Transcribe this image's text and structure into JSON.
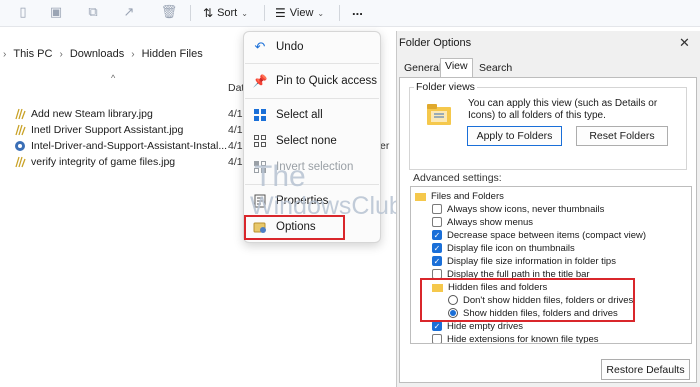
{
  "toolbar": {
    "sort_label": "Sort",
    "view_label": "View",
    "more_label": "..."
  },
  "breadcrumb": {
    "segments": [
      "This PC",
      "Downloads",
      "Hidden Files"
    ]
  },
  "file_list": {
    "files": [
      {
        "name": "Add new Steam library.jpg",
        "date": "4/1"
      },
      {
        "name": "Inetl Driver Support Assistant.jpg",
        "date": "4/1"
      },
      {
        "name": "Intel-Driver-and-Support-Assistant-Instal...",
        "date": "4/1"
      },
      {
        "name": "verify integrity of game files.jpg",
        "date": "4/1"
      }
    ],
    "date_header": "Dat",
    "overflow_text": "older"
  },
  "context_menu": {
    "items": [
      {
        "label": "Undo",
        "icon": "undo-icon",
        "disabled": false
      },
      {
        "label": "Pin to Quick access",
        "icon": "pin-icon",
        "disabled": false
      },
      {
        "label": "Select all",
        "icon": "select-all-icon",
        "disabled": false
      },
      {
        "label": "Select none",
        "icon": "select-none-icon",
        "disabled": false
      },
      {
        "label": "Invert selection",
        "icon": "invert-selection-icon",
        "disabled": true
      },
      {
        "label": "Properties",
        "icon": "properties-icon",
        "disabled": false
      },
      {
        "label": "Options",
        "icon": "options-icon",
        "disabled": false
      }
    ]
  },
  "watermark": {
    "line1": "The",
    "line2": "WindowsClub"
  },
  "dialog": {
    "title": "Folder Options",
    "tabs": [
      "General",
      "View",
      "Search"
    ],
    "active_tab": "View",
    "folder_views": {
      "title": "Folder views",
      "description": "You can apply this view (such as Details or Icons) to all folders of this type.",
      "apply_button": "Apply to Folders",
      "reset_button": "Reset Folders"
    },
    "advanced_label": "Advanced settings:",
    "settings": [
      {
        "label": "Files and Folders",
        "kind": "folder"
      },
      {
        "label": "Always show icons, never thumbnails",
        "kind": "checkbox",
        "checked": false
      },
      {
        "label": "Always show menus",
        "kind": "checkbox",
        "checked": false
      },
      {
        "label": "Decrease space between items (compact view)",
        "kind": "checkbox",
        "checked": true
      },
      {
        "label": "Display file icon on thumbnails",
        "kind": "checkbox",
        "checked": true
      },
      {
        "label": "Display file size information in folder tips",
        "kind": "checkbox",
        "checked": true
      },
      {
        "label": "Display the full path in the title bar",
        "kind": "checkbox",
        "checked": false
      },
      {
        "label": "Hidden files and folders",
        "kind": "folder"
      },
      {
        "label": "Don't show hidden files, folders or drives",
        "kind": "radio",
        "checked": false
      },
      {
        "label": "Show hidden files, folders and drives",
        "kind": "radio",
        "checked": true
      },
      {
        "label": "Hide empty drives",
        "kind": "checkbox",
        "checked": true
      },
      {
        "label": "Hide extensions for known file types",
        "kind": "checkbox",
        "checked": false
      }
    ],
    "restore_button": "Restore Defaults"
  },
  "colors": {
    "accent": "#1a6fd8",
    "highlight_box": "#d9262b",
    "disabled_text": "#9aa0a6"
  }
}
